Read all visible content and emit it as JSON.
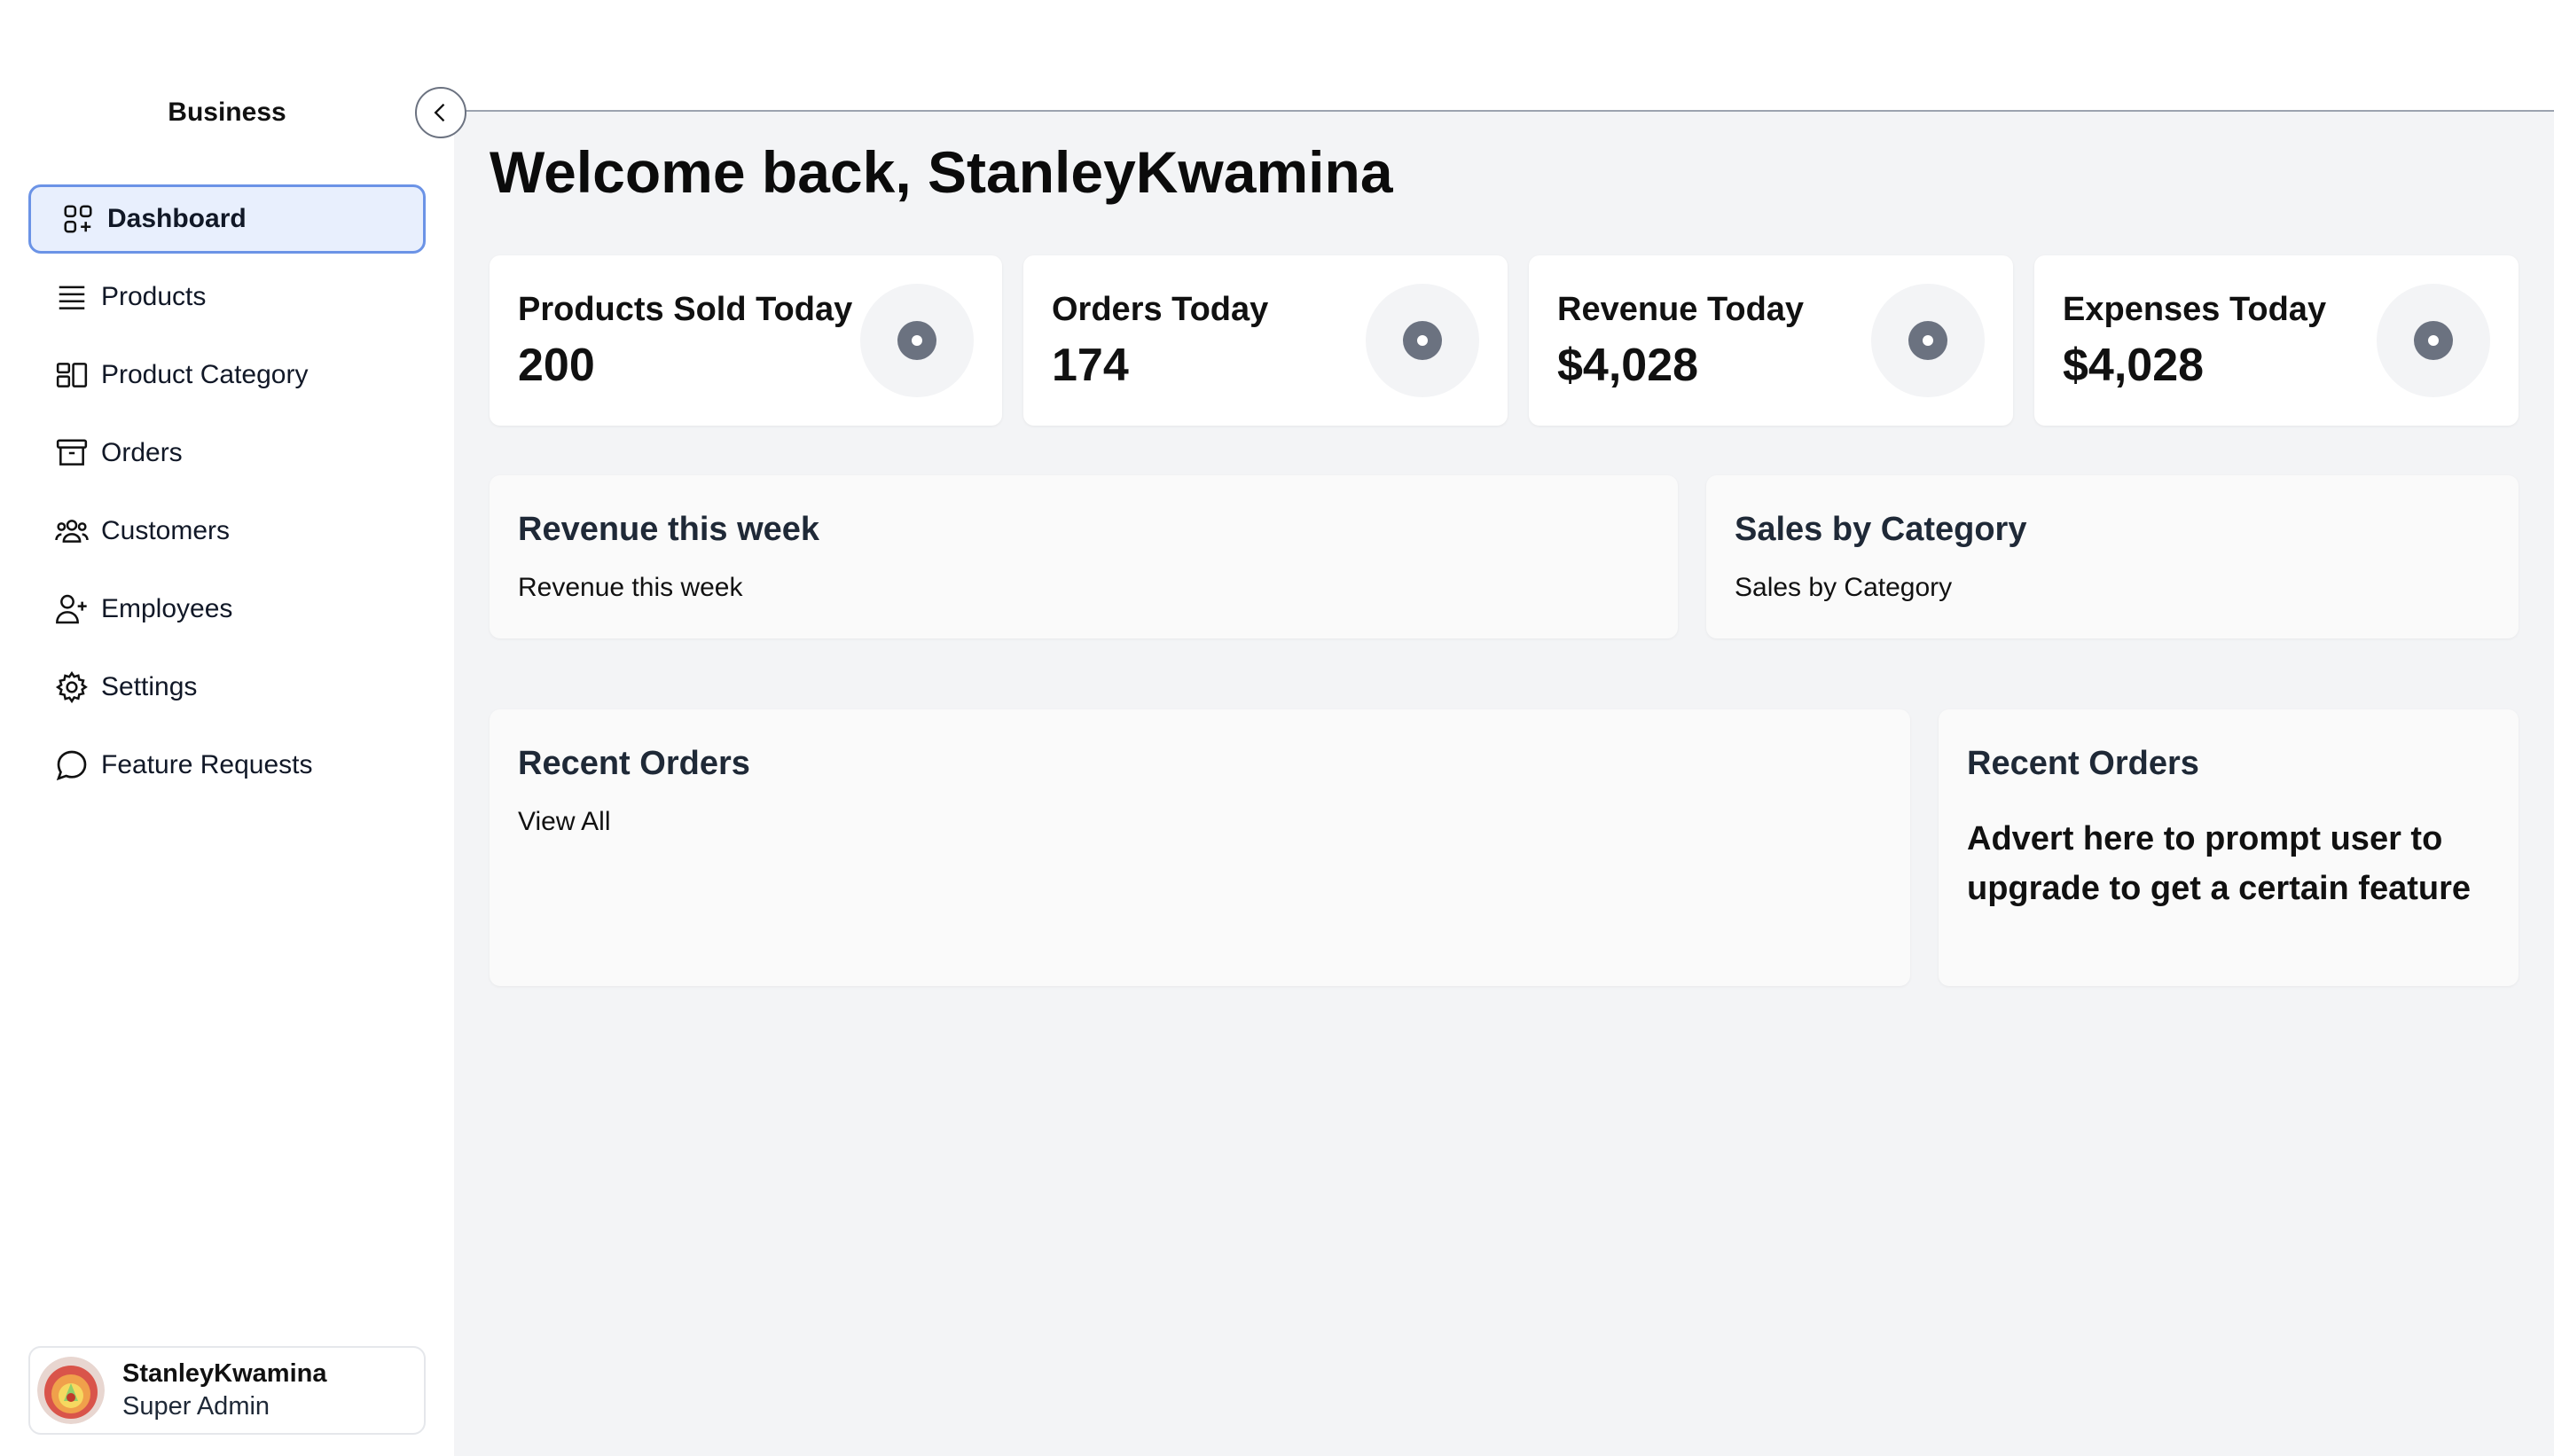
{
  "sidebar": {
    "brand": "Business",
    "items": [
      {
        "label": "Dashboard",
        "icon": "dashboard-icon",
        "active": true
      },
      {
        "label": "Products",
        "icon": "list-icon"
      },
      {
        "label": "Product Category",
        "icon": "category-icon"
      },
      {
        "label": "Orders",
        "icon": "archive-box-icon"
      },
      {
        "label": "Customers",
        "icon": "users-icon"
      },
      {
        "label": "Employees",
        "icon": "user-plus-icon"
      },
      {
        "label": "Settings",
        "icon": "gear-icon"
      },
      {
        "label": "Feature Requests",
        "icon": "chat-bubble-icon"
      }
    ],
    "user": {
      "name": "StanleyKwamina",
      "role": "Super Admin"
    }
  },
  "main": {
    "welcome": "Welcome back, StanleyKwamina",
    "stats": [
      {
        "label": "Products Sold Today",
        "value": "200"
      },
      {
        "label": "Orders Today",
        "value": "174"
      },
      {
        "label": "Revenue Today",
        "value": "$4,028"
      },
      {
        "label": "Expenses Today",
        "value": "$4,028"
      }
    ],
    "revenue_panel": {
      "title": "Revenue this week",
      "subtitle": "Revenue this week"
    },
    "category_panel": {
      "title": "Sales by Category",
      "subtitle": "Sales by Category"
    },
    "recent_orders": {
      "title": "Recent Orders",
      "link": "View All"
    },
    "advert_panel": {
      "title": "Recent Orders",
      "text": "Advert here to prompt user to upgrade to get a certain feature"
    }
  },
  "colors": {
    "accent": "#6b93e6",
    "active_bg": "#e8effd",
    "page_bg": "#f3f4f6",
    "stat_icon": "#6b7280"
  }
}
